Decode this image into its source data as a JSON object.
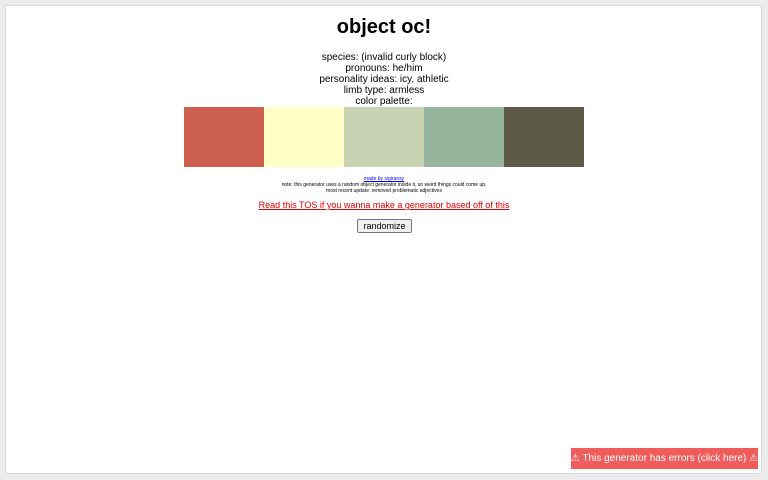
{
  "title": "object oc!",
  "info": {
    "species": "species: (invalid curly block)",
    "pronouns": "pronouns: he/him",
    "personality": "personality ideas: icy, athletic",
    "limb_type": "limb type: armless",
    "palette_label": "color palette:"
  },
  "palette": {
    "colors": [
      "#cd5f4f",
      "#fefec6",
      "#c9d3b3",
      "#97b59c",
      "#5d5a47"
    ]
  },
  "credits": {
    "made_by": "made by sigiransy",
    "note": "note: this generator uses a random object generator inside it, so weird things could come up.",
    "update": "most recent update: removed problematic adjectives"
  },
  "tos_link": "Read this TOS if you wanna make a generator based off of this",
  "randomize_label": "randomize",
  "error_bar": "⚠ This generator has errors (click here) ⚠"
}
